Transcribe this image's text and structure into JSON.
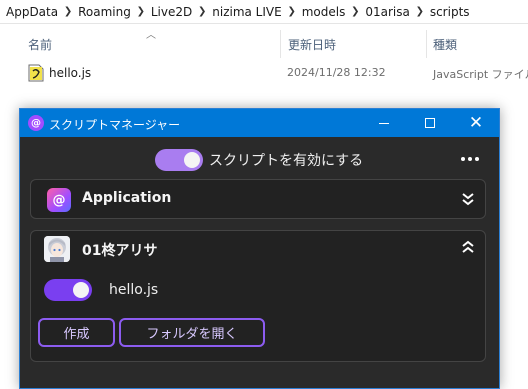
{
  "explorer": {
    "breadcrumb": [
      "AppData",
      "Roaming",
      "Live2D",
      "nizima LIVE",
      "models",
      "01arisa",
      "scripts"
    ],
    "columns": {
      "name": "名前",
      "date": "更新日時",
      "type": "種類"
    },
    "files": [
      {
        "name": "hello.js",
        "date": "2024/11/28 12:32",
        "type": "JavaScript ファイル"
      }
    ]
  },
  "window": {
    "title": "スクリプトマネージャー",
    "master_toggle_label": "スクリプトを有効にする",
    "master_enabled": true,
    "sections": {
      "application": {
        "title": "Application"
      },
      "model": {
        "title": "01柊アリサ",
        "scripts": [
          {
            "name": "hello.js",
            "enabled": true
          }
        ],
        "create_label": "作成",
        "open_folder_label": "フォルダを開く"
      }
    }
  },
  "colors": {
    "titlebar": "#0078d7",
    "accent_purple": "#8c5cf0",
    "toggle_on": "#7a3ff0",
    "panel_bg": "#2a2a2a"
  },
  "icons": {
    "file": "js-file-icon",
    "app": "nizima-app-icon",
    "collapse": "double-chevron-up-icon",
    "expand": "double-chevron-down-icon"
  }
}
